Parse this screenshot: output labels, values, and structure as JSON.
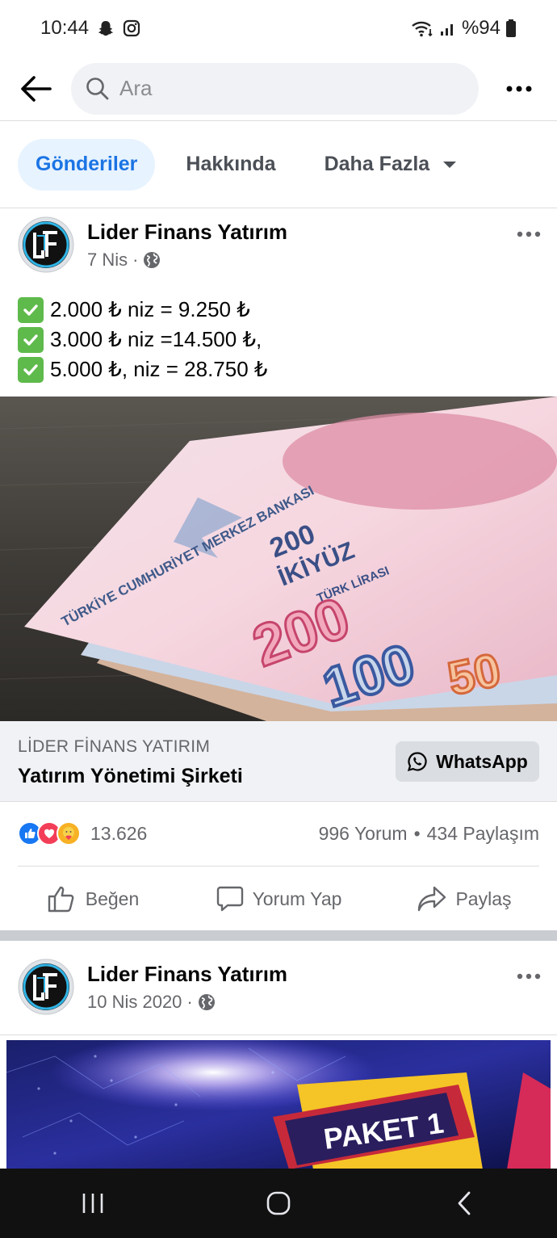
{
  "status_bar": {
    "time": "10:44",
    "battery": "%94"
  },
  "search": {
    "placeholder": "Ara"
  },
  "tabs": [
    {
      "label": "Gönderiler",
      "active": true
    },
    {
      "label": "Hakkında",
      "active": false
    },
    {
      "label": "Daha Fazla",
      "active": false
    }
  ],
  "post1": {
    "page_name": "Lider Finans Yatırım",
    "date": "7 Nis",
    "lines": [
      "2.000 ₺ niz = 9.250 ₺",
      "3.000 ₺ niz =14.500 ₺,",
      "5.000 ₺, niz = 28.750 ₺"
    ],
    "image_banknote_labels": [
      "200",
      "İKİYÜZ",
      "TÜRK LİRASI",
      "TÜRKİYE CUMHURİYET MERKEZ BANKASI",
      "100",
      "50"
    ],
    "cta": {
      "label": "LİDER FİNANS YATIRIM",
      "title": "Yatırım Yönetimi Şirketi",
      "button": "WhatsApp"
    },
    "reactions_count": "13.626",
    "comments": "996 Yorum",
    "shares": "434 Paylaşım",
    "actions": {
      "like": "Beğen",
      "comment": "Yorum Yap",
      "share": "Paylaş"
    }
  },
  "post2": {
    "page_name": "Lider Finans Yatırım",
    "date": "10 Nis 2020",
    "image_text": "PAKET 1"
  },
  "colors": {
    "accent": "#1b74e4",
    "tab_active_bg": "#e7f3ff",
    "check": "#5fba4c"
  }
}
